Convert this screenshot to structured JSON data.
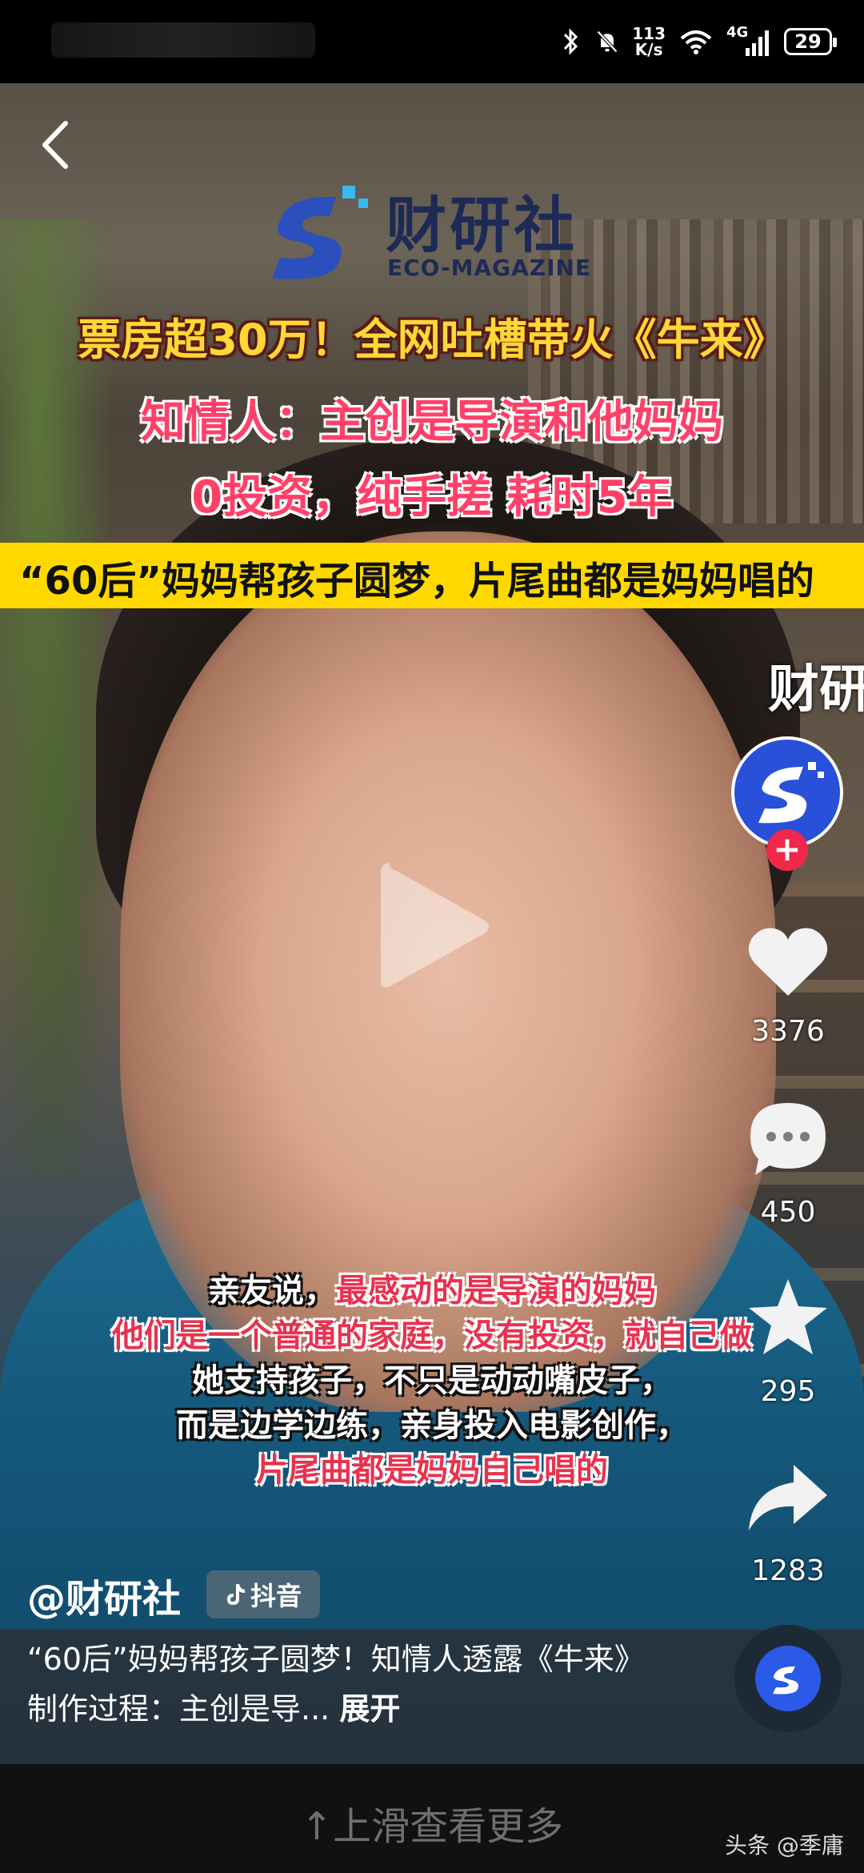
{
  "status_bar": {
    "net_speed_value": "113",
    "net_speed_unit": "K/s",
    "network": "4G",
    "battery": "29",
    "icons": [
      "bluetooth-icon",
      "mute-bell-icon",
      "wifi-icon",
      "cellular-signal-icon",
      "battery-icon"
    ]
  },
  "video": {
    "brand_name": "财研社",
    "brand_sub": "ECO-MAGAZINE",
    "headline_1": "票房超30万！全网吐槽带火《牛来》",
    "headline_2": "知情人：主创是导演和他妈妈",
    "headline_3": "0投资，纯手搓 耗时5年",
    "banner": "“60后”妈妈帮孩子圆梦，片尾曲都是妈妈唱的",
    "side_brand": "财研",
    "subtitles": [
      {
        "a": "亲友说，",
        "b": "最感动的是导演的妈妈"
      },
      {
        "text": "他们是一个普通的家庭，没有投资，就自己做"
      },
      {
        "text": "她支持孩子，不只是动动嘴皮子，"
      },
      {
        "text": "而是边学边练，亲身投入电影创作，"
      },
      {
        "text": "片尾曲都是妈妈自己唱的"
      }
    ]
  },
  "rail": {
    "likes": "3376",
    "comments": "450",
    "favorites": "295",
    "shares": "1283"
  },
  "author": {
    "handle": "@财研社",
    "platform_tag": "抖音"
  },
  "caption": {
    "text": "“60后”妈妈帮孩子圆梦！知情人透露《牛来》制作过程：主创是导...",
    "expand": "展开"
  },
  "bottom": {
    "swipe_hint": "↑上滑查看更多",
    "watermark": "头条 @季庸"
  },
  "colors": {
    "headline_yellow": "#ffd736",
    "headline_red": "#ff4068",
    "banner_yellow": "#ffd800",
    "brand_blue": "#2b5ae6"
  }
}
